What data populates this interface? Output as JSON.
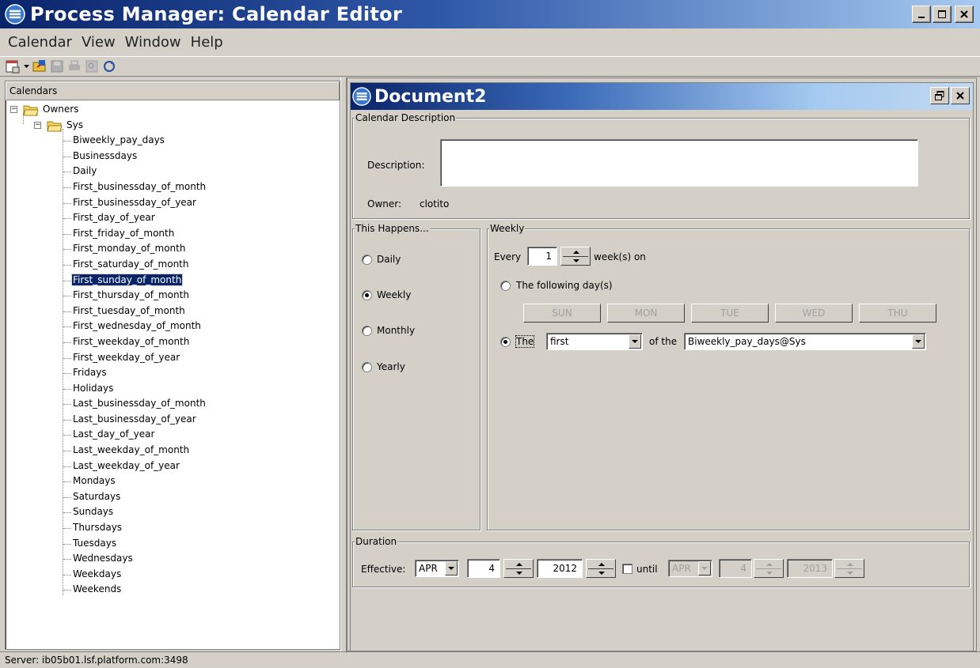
{
  "app": {
    "title": "Process Manager: Calendar Editor"
  },
  "menu": {
    "items": [
      "Calendar",
      "View",
      "Window",
      "Help"
    ]
  },
  "toolbar": {
    "icons": [
      "new-calendar-icon",
      "open-icon",
      "save-icon",
      "print-icon",
      "preview-icon",
      "refresh-icon"
    ]
  },
  "left": {
    "header": "Calendars",
    "root": "Owners",
    "owner": "Sys",
    "selected": "First_sunday_of_month",
    "calendars": [
      "Biweekly_pay_days",
      "Businessdays",
      "Daily",
      "First_businessday_of_month",
      "First_businessday_of_year",
      "First_day_of_year",
      "First_friday_of_month",
      "First_monday_of_month",
      "First_saturday_of_month",
      "First_sunday_of_month",
      "First_thursday_of_month",
      "First_tuesday_of_month",
      "First_wednesday_of_month",
      "First_weekday_of_month",
      "First_weekday_of_year",
      "Fridays",
      "Holidays",
      "Last_businessday_of_month",
      "Last_businessday_of_year",
      "Last_day_of_year",
      "Last_weekday_of_month",
      "Last_weekday_of_year",
      "Mondays",
      "Saturdays",
      "Sundays",
      "Thursdays",
      "Tuesdays",
      "Wednesdays",
      "Weekdays",
      "Weekends"
    ]
  },
  "status": {
    "server": "Server: ib05b01.lsf.platform.com:3498"
  },
  "document": {
    "title": "Document2",
    "calendar_description": {
      "group_title": "Calendar Description",
      "description_label": "Description:",
      "description_value": "",
      "owner_label": "Owner:",
      "owner_value": "clotito"
    },
    "this_happens": {
      "group_title": "This Happens...",
      "options": [
        "Daily",
        "Weekly",
        "Monthly",
        "Yearly"
      ],
      "selected": "Weekly"
    },
    "weekly": {
      "group_title": "Weekly",
      "every_label": "Every",
      "every_value": "1",
      "weeks_on_label": "week(s) on",
      "following_days_label": "The following day(s)",
      "days": [
        "SUN",
        "MON",
        "TUE",
        "WED",
        "THU"
      ],
      "the_label": "The",
      "ordinal_value": "first",
      "of_the_label": "of the",
      "calendar_value": "Biweekly_pay_days@Sys"
    },
    "duration": {
      "group_title": "Duration",
      "effective_label": "Effective:",
      "start_month": "APR",
      "start_day": "4",
      "start_year": "2012",
      "until_label": "until",
      "until_checked": false,
      "end_month": "APR",
      "end_day": "4",
      "end_year": "2013"
    }
  }
}
